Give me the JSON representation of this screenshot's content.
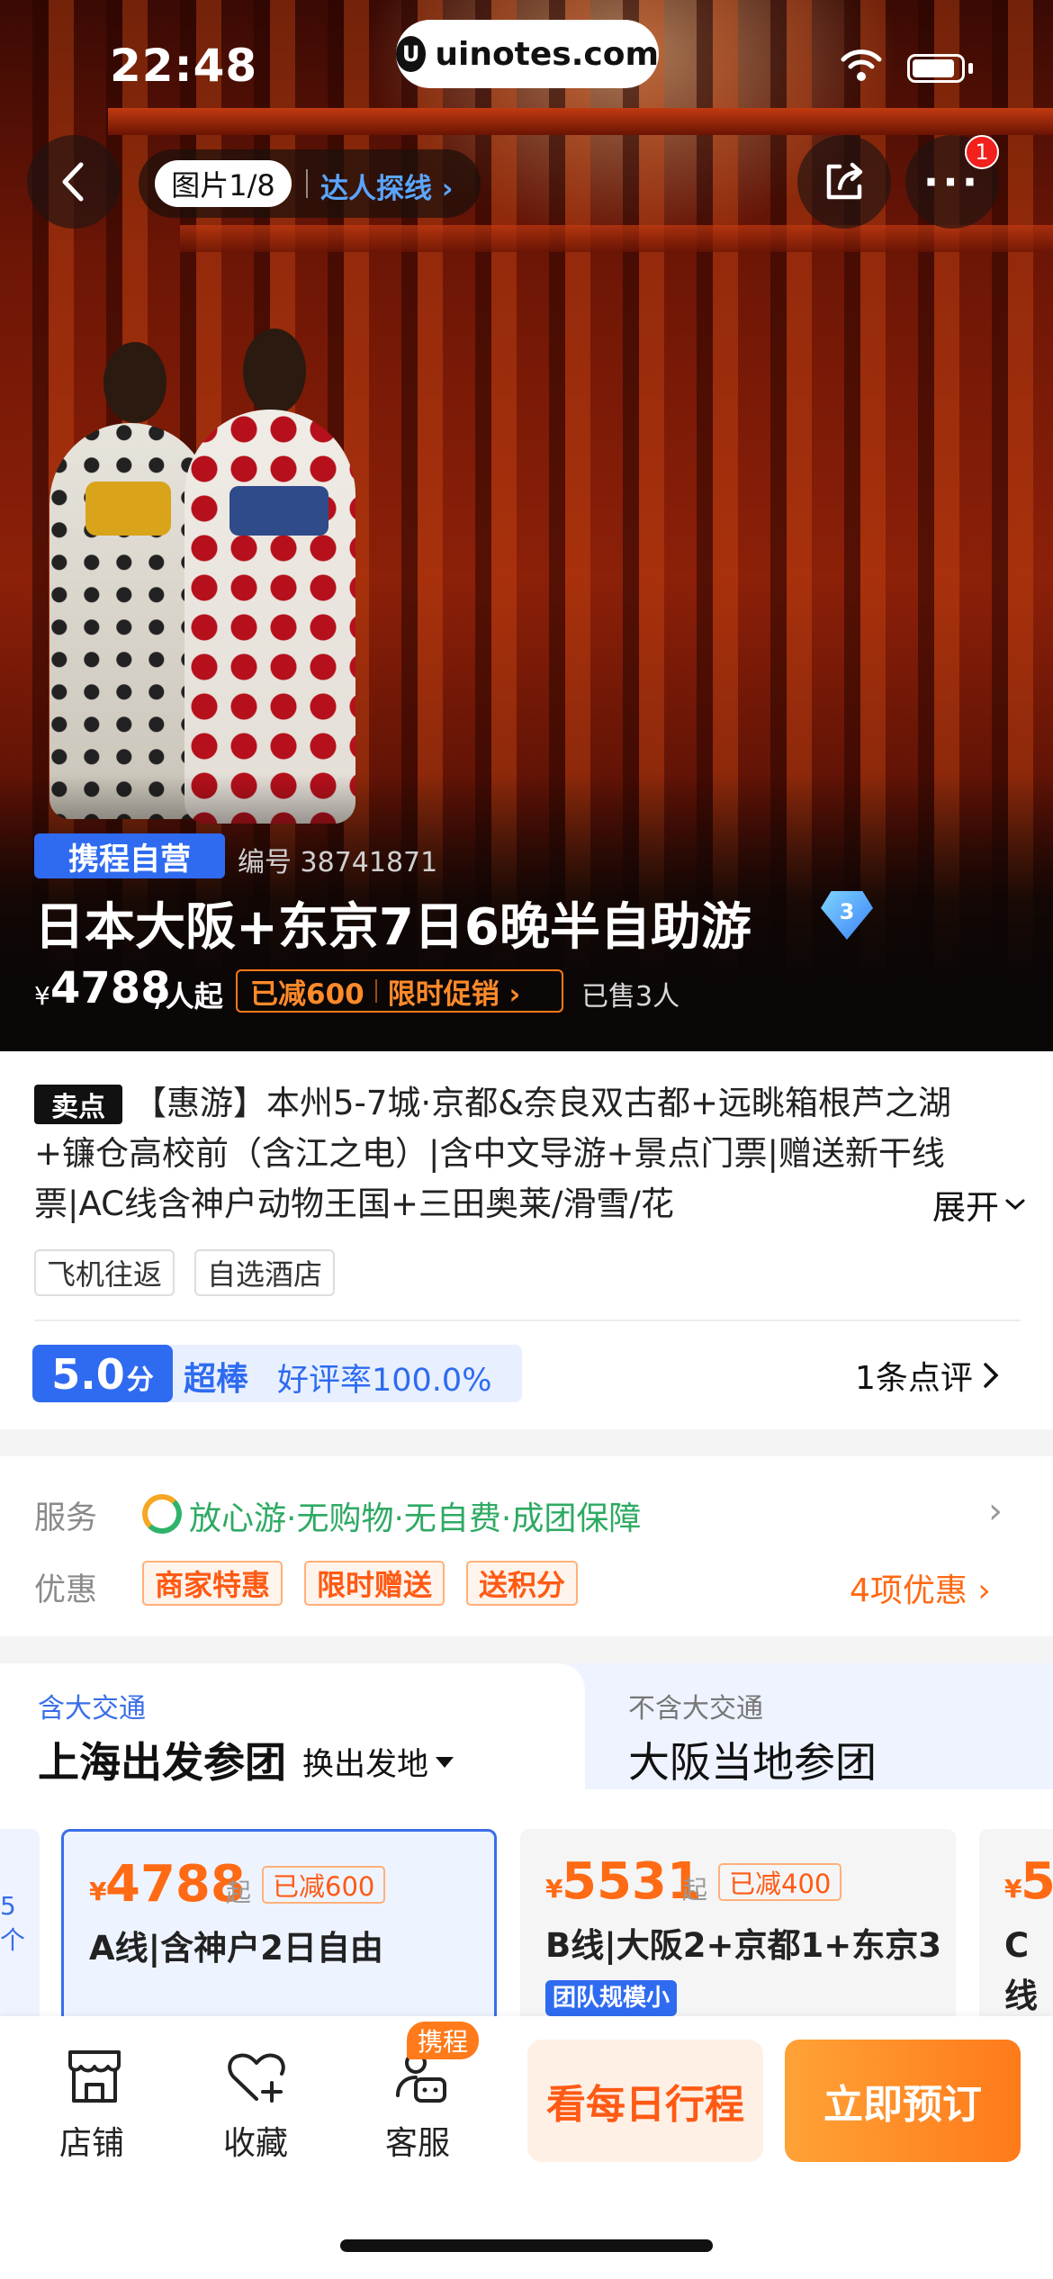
{
  "status_bar": {
    "time": "22:48",
    "url": "uinotes.com"
  },
  "nav": {
    "photo_counter": "图片1/8",
    "expert_link": "达人探线 ›",
    "more_badge": "1"
  },
  "product": {
    "badge": "携程自营",
    "product_no": "编号 38741871",
    "title": "日本大阪+东京7日6晚半自助游",
    "diamond_level": "3",
    "price_symbol": "¥",
    "price": "4788",
    "price_unit": "/人起",
    "discount": "已减600",
    "promo": "限时促销 ›",
    "sold": "已售3人"
  },
  "selling_points": {
    "tag": "卖点",
    "text": "【惠游】本州5-7城·京都&奈良双古都+远眺箱根芦之湖+镰仓高校前（含江之电）|含中文导游+景点门票|赠送新干线票|AC线含神户动物王国+三田奥莱/滑雪/花",
    "expand": "展开"
  },
  "chips": [
    "飞机往返",
    "自选酒店"
  ],
  "rating": {
    "score": "5.0",
    "score_unit": "分",
    "word": "超棒",
    "rate": "好评率100.0%",
    "reviews": "1条点评"
  },
  "service": {
    "label": "服务",
    "text": "放心游·无购物·无自费·成团保障"
  },
  "offers": {
    "label": "优惠",
    "tags": [
      "商家特惠",
      "限时赠送",
      "送积分"
    ],
    "count": "4项优惠 ›"
  },
  "route_tabs": {
    "active_sub": "含大交通",
    "active_title": "上海出发参团",
    "switch": "换出发地",
    "other_sub": "不含大交通",
    "other_title": "大阪当地参团"
  },
  "routes": {
    "side_peek": "5个",
    "a": {
      "sym": "¥",
      "price": "4788",
      "qi": "起",
      "off": "已减600",
      "name": "A线|含神户2日自由"
    },
    "b": {
      "sym": "¥",
      "price": "5531",
      "qi": "起",
      "off": "已减400",
      "name": "B线|大阪2+京都1+东京3",
      "tag": "团队规模小"
    },
    "c": {
      "sym": "¥",
      "price": "5",
      "name": "C线自由"
    }
  },
  "bottom_bar": {
    "store": "店铺",
    "favorite": "收藏",
    "service": "客服",
    "service_badge": "携程",
    "schedule_btn": "看每日行程",
    "book_btn": "立即预订"
  },
  "colors": {
    "brand_blue": "#2f6bf0",
    "accent_orange": "#ff6a14",
    "service_green": "#2eaa63"
  }
}
